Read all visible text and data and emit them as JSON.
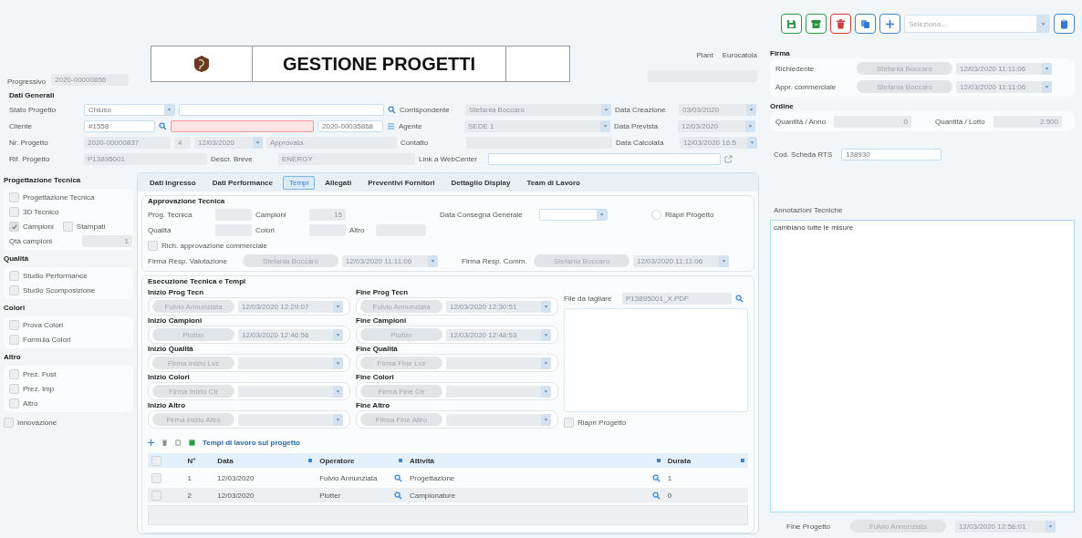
{
  "toolbar": {
    "buttons": [
      {
        "kind": "save"
      },
      {
        "kind": "archive"
      },
      {
        "kind": "delete"
      },
      {
        "kind": "copy"
      },
      {
        "kind": "add"
      }
    ],
    "select": {
      "placeholder": "Seleziona..."
    },
    "side_button": {
      "kind": "clipboard"
    }
  },
  "header": {
    "progressivo": {
      "label": "Progressivo",
      "value": "2020-00000856"
    },
    "title": "GESTIONE PROGETTI",
    "plant": {
      "label": "Plant",
      "value": "Eurocatola"
    }
  },
  "dati_generali": {
    "title": "Dati Generali",
    "stato_progetto": {
      "label": "Stato Progetto",
      "value": "Chiuso"
    },
    "cliente": {
      "label": "Cliente",
      "code": "#1558",
      "name_error": true,
      "number": "2020-00035868"
    },
    "nr_progetto": {
      "label": "Nr. Progetto",
      "value": "2020-00000837",
      "revision": "4",
      "date": "12/03/2020",
      "status": "Approvata"
    },
    "rif_progetto": {
      "label": "Rif. Progetto",
      "value": "P13895001"
    },
    "descr_breve": {
      "label": "Descr. Breve",
      "value": "ENERGY"
    },
    "corrispondente": {
      "label": "Corrispondente",
      "value": "Stefania Boccaro"
    },
    "agente": {
      "label": "Agente",
      "value": "SEDE 1"
    },
    "contatto": {
      "label": "Contatto"
    },
    "link_webcenter": {
      "label": "Link a WebCenter"
    },
    "data_creazione": {
      "label": "Data Creazione",
      "value": "03/03/2020"
    },
    "data_prevista": {
      "label": "Data Prevista",
      "value": "12/03/2020"
    },
    "data_calcolata": {
      "label": "Data Calcolata",
      "value": "12/03/2020 16:5"
    }
  },
  "sidebar": {
    "groups": [
      {
        "title": "Progettazione Tecnica",
        "rows": [
          [
            {
              "label": "Progettazione Tecnica",
              "checked": false
            }
          ],
          [
            {
              "label": "3D Tecnico",
              "checked": false
            }
          ],
          [
            {
              "label": "Campioni",
              "checked": true
            },
            {
              "label": "Stampati",
              "checked": false
            }
          ]
        ],
        "quantity": {
          "label": "Qtà campioni",
          "value": "1"
        }
      },
      {
        "title": "Qualità",
        "rows": [
          [
            {
              "label": "Studio Performance",
              "checked": false
            }
          ],
          [
            {
              "label": "Studio Scomposizione",
              "checked": false
            }
          ]
        ]
      },
      {
        "title": "Colori",
        "rows": [
          [
            {
              "label": "Prova Colori",
              "checked": false
            }
          ],
          [
            {
              "label": "Formula Colori",
              "checked": false
            }
          ]
        ]
      },
      {
        "title": "Altro",
        "rows": [
          [
            {
              "label": "Prez. Fust",
              "checked": false
            }
          ],
          [
            {
              "label": "Prez. Imp",
              "checked": false
            }
          ],
          [
            {
              "label": "Altro",
              "checked": false
            }
          ]
        ]
      }
    ],
    "innovazione": {
      "label": "Innovazione",
      "checked": false
    }
  },
  "tabs": [
    {
      "label": "Dati Ingresso",
      "selected": false
    },
    {
      "label": "Dati Performance",
      "selected": false
    },
    {
      "label": "Tempi",
      "selected": true
    },
    {
      "label": "Allegati",
      "selected": false
    },
    {
      "label": "Preventivi Fornitori",
      "selected": false
    },
    {
      "label": "Dettaglio Display",
      "selected": false
    },
    {
      "label": "Team di Lavoro",
      "selected": false
    }
  ],
  "approvazione": {
    "title": "Approvazione Tecnica",
    "prog_tecnica": {
      "label": "Prog. Tecnica"
    },
    "campioni": {
      "label": "Campioni",
      "value": "15"
    },
    "qualita": {
      "label": "Qualità"
    },
    "colori": {
      "label": "Colori"
    },
    "altro": {
      "label": "Altro"
    },
    "data_consegna": {
      "label": "Data Consegna Generale"
    },
    "riapri": {
      "label": "Riapri Progetto",
      "checked": false
    },
    "rich_approvazione": {
      "label": "Rich. approvazione commerciale",
      "checked": false
    },
    "firma_valutazione": {
      "label": "Firma Resp. Valutazione",
      "signer": "Stefania Boccaro",
      "date": "12/03/2020 11:11:06"
    },
    "firma_comm": {
      "label": "Firma Resp. Comm.",
      "signer": "Stefania Boccaro",
      "date": "12/03/2020 11:11:06"
    }
  },
  "esecuzione": {
    "title": "Esecuzione Tecnica e Tempi",
    "phases": [
      {
        "start": {
          "title": "Inizio Prog Tecn",
          "signer": "Fulvio Annunziata",
          "date": "12/03/2020 12:29:07"
        },
        "end": {
          "title": "Fine Prog Tecn",
          "signer": "Fulvio Annunziata",
          "date": "12/03/2020 12:30:51"
        }
      },
      {
        "start": {
          "title": "Inizio Campioni",
          "signer": "Plotter",
          "date": "12/03/2020 12:46:56"
        },
        "end": {
          "title": "Fine Campioni",
          "signer": "Plotter",
          "date": "12/03/2020 12:48:53"
        }
      },
      {
        "start": {
          "title": "Inizio Qualità",
          "signer": "Firma Inizio Lvz"
        },
        "end": {
          "title": "Fine Qualità",
          "signer": "Firma Fine Lvz"
        }
      },
      {
        "start": {
          "title": "Inizio Colori",
          "signer": "Firma Inizio Clr"
        },
        "end": {
          "title": "Fine Colori",
          "signer": "Firma Fine Clr"
        }
      },
      {
        "start": {
          "title": "Inizio Altro",
          "signer": "Firma Inizio Altro"
        },
        "end": {
          "title": "Fine Altro",
          "signer": "Firma Fine Altro"
        }
      }
    ],
    "file": {
      "label": "File da tagliare",
      "value": "P13895001_X.PDF"
    },
    "riapri": {
      "label": "Riapri Progetto",
      "checked": false
    },
    "work_times": {
      "title": "Tempi di lavoro sul progetto",
      "all_selected": false,
      "columns": [
        "N°",
        "Data",
        "Operatore",
        "Attività",
        "Durata"
      ],
      "rows": [
        {
          "selected": false,
          "cells": [
            "1",
            "12/03/2020",
            "Fulvio Annunziata",
            "Progettazione",
            "1"
          ]
        },
        {
          "selected": false,
          "cells": [
            "2",
            "12/03/2020",
            "Plotter",
            "Campionature",
            "0"
          ]
        }
      ]
    }
  },
  "firma": {
    "title": "Firma",
    "rows": [
      {
        "label": "Richiedente",
        "signer": "Stefania Boccaro",
        "date": "12/03/2020 11:11:06"
      },
      {
        "label": "Appr. commerciale",
        "signer": "Stefania Boccaro",
        "date": "12/03/2020 11:11:06"
      }
    ]
  },
  "ordine": {
    "title": "Ordine",
    "quantita_anno": {
      "label": "Quantità / Anno",
      "value": "0"
    },
    "quantita_lotto": {
      "label": "Quantità / Lotto",
      "value": "2.500"
    }
  },
  "cod_scheda": {
    "label": "Cod. Scheda RTS",
    "value": "138930"
  },
  "annotazioni": {
    "label": "Annotazioni Tecniche",
    "value": "cambiano tutte le misure"
  },
  "fine_progetto": {
    "label": "Fine Progetto",
    "signer": "Fulvio Annunziata",
    "date": "12/03/2020 12:58:01"
  }
}
